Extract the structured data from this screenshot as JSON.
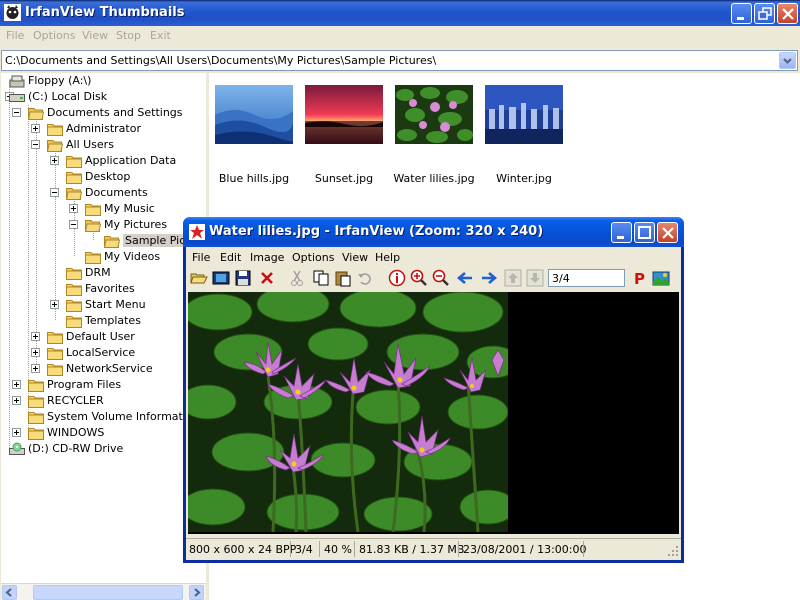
{
  "window": {
    "title": "IrfanView Thumbnails"
  },
  "menu": {
    "file": "File",
    "options": "Options",
    "view": "View",
    "stop": "Stop",
    "exit": "Exit"
  },
  "address": {
    "path": "C:\\Documents and Settings\\All Users\\Documents\\My Pictures\\Sample Pictures\\"
  },
  "tree": {
    "items": [
      {
        "label": "Floppy (A:\\)"
      },
      {
        "label": "(C:) Local Disk"
      },
      {
        "label": "Documents and Settings"
      },
      {
        "label": "Administrator"
      },
      {
        "label": "All Users"
      },
      {
        "label": "Application Data"
      },
      {
        "label": "Desktop"
      },
      {
        "label": "Documents"
      },
      {
        "label": "My Music"
      },
      {
        "label": "My Pictures"
      },
      {
        "label": "Sample Pictures"
      },
      {
        "label": "My Videos"
      },
      {
        "label": "DRM"
      },
      {
        "label": "Favorites"
      },
      {
        "label": "Start Menu"
      },
      {
        "label": "Templates"
      },
      {
        "label": "Default User"
      },
      {
        "label": "LocalService"
      },
      {
        "label": "NetworkService"
      },
      {
        "label": "Program Files"
      },
      {
        "label": "RECYCLER"
      },
      {
        "label": "System Volume Information"
      },
      {
        "label": "WINDOWS"
      },
      {
        "label": "(D:) CD-RW Drive"
      }
    ]
  },
  "thumbnails": [
    {
      "name": "Blue hills.jpg"
    },
    {
      "name": "Sunset.jpg"
    },
    {
      "name": "Water lilies.jpg"
    },
    {
      "name": "Winter.jpg"
    }
  ],
  "viewer": {
    "title": "Water lilies.jpg - IrfanView (Zoom: 320 x 240)",
    "menu": {
      "file": "File",
      "edit": "Edit",
      "image": "Image",
      "options": "Options",
      "view": "View",
      "help": "Help"
    },
    "page_field": "3/4",
    "status": {
      "dimensions": "800 x 600 x 24 BPP",
      "index": "3/4",
      "zoom": "40 %",
      "size": "81.83 KB / 1.37 MB",
      "datetime": "23/08/2001 / 13:00:00"
    }
  },
  "colors": {
    "titlebar": "#2358D0",
    "selection": "#316AC5",
    "folder": "#F4D56A"
  }
}
